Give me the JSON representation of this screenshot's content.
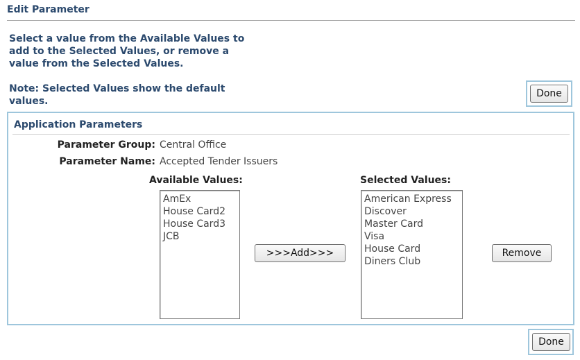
{
  "header": {
    "title": "Edit Parameter"
  },
  "instructions": {
    "main": "Select a value from the Available Values to add to the Selected Values, or remove a value from the Selected Values.",
    "note": "Note: Selected Values show the default values."
  },
  "buttons": {
    "done": "Done",
    "add": ">>>Add>>>",
    "remove": "Remove"
  },
  "panel": {
    "title": "Application Parameters",
    "parameter_group_label": "Parameter Group:",
    "parameter_group_value": "Central Office",
    "parameter_name_label": "Parameter Name:",
    "parameter_name_value": "Accepted Tender Issuers",
    "available_label": "Available Values:",
    "selected_label": "Selected Values:",
    "available_values": [
      "AmEx",
      "House Card2",
      "House Card3",
      "JCB"
    ],
    "selected_values": [
      "American Express",
      "Discover",
      "Master Card",
      "Visa",
      "House Card",
      "Diners Club"
    ]
  }
}
